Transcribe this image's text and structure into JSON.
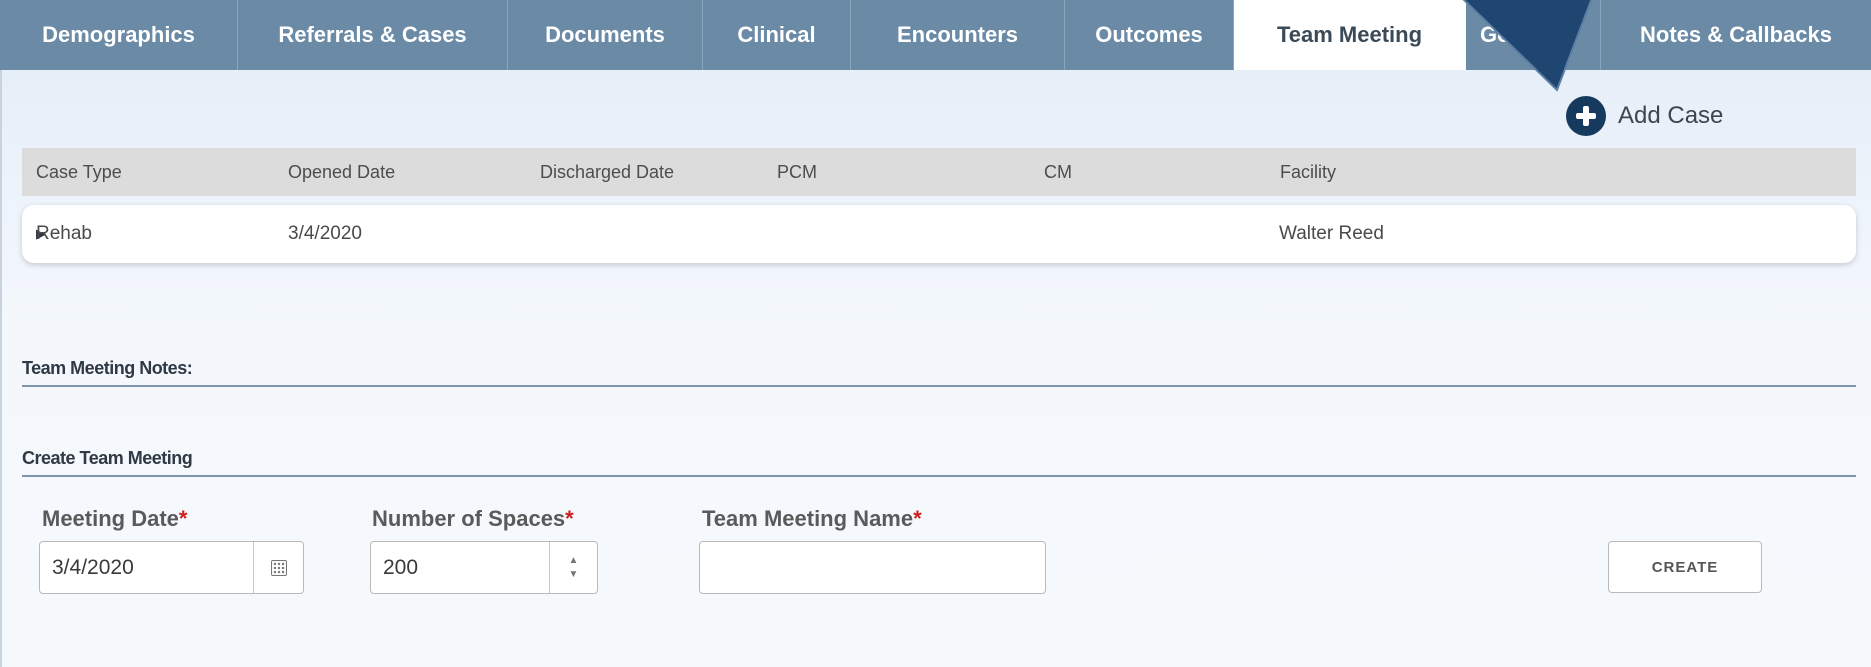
{
  "tabs": [
    {
      "label": "Demographics"
    },
    {
      "label": "Referrals & Cases"
    },
    {
      "label": "Documents"
    },
    {
      "label": "Clinical"
    },
    {
      "label": "Encounters"
    },
    {
      "label": "Outcomes"
    },
    {
      "label": "Team Meeting"
    },
    {
      "label": "Goa"
    },
    {
      "label": "Notes & Callbacks"
    }
  ],
  "active_tab": "Team Meeting",
  "add_case": {
    "label": "Add Case",
    "icon": "plus-circle-icon"
  },
  "cases_table": {
    "columns": [
      "Case Type",
      "Opened Date",
      "Discharged Date",
      "PCM",
      "CM",
      "Facility"
    ],
    "rows": [
      {
        "case_type": "Rehab",
        "opened_date": "3/4/2020",
        "discharged_date": "",
        "pcm": "",
        "cm": "",
        "facility": "Walter Reed"
      }
    ]
  },
  "team_meeting_notes": {
    "title": "Team Meeting Notes:"
  },
  "create_team_meeting": {
    "title": "Create Team Meeting",
    "meeting_date": {
      "label": "Meeting Date",
      "required_mark": "*",
      "value": "3/4/2020"
    },
    "number_of_spaces": {
      "label": "Number of Spaces",
      "required_mark": "*",
      "value": "200"
    },
    "team_meeting_name": {
      "label": "Team Meeting Name",
      "required_mark": "*",
      "value": ""
    },
    "create_label": "CREATE"
  },
  "colors": {
    "tab_bar": "#6a8aa6",
    "accent_dark": "#163a5e",
    "required": "#cc1f1f",
    "callout": "#1e4670"
  }
}
